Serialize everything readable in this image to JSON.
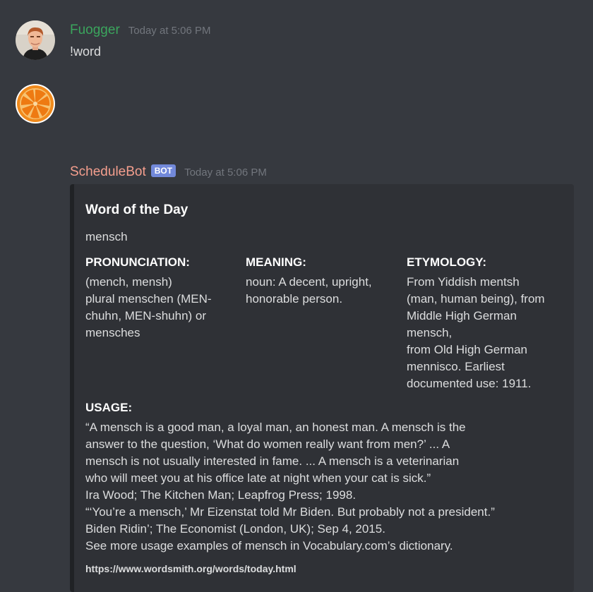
{
  "messages": [
    {
      "username": "Fuogger",
      "timestamp": "Today at 5:06 PM",
      "content": "!word"
    },
    {
      "username": "ScheduleBot",
      "bot_tag": "BOT",
      "timestamp": "Today at 5:06 PM",
      "embed": {
        "title": "Word of the Day",
        "description": "mensch",
        "fields": [
          {
            "name": "PRONUNCIATION:",
            "value": "(mench, mensh)\nplural menschen (MEN-\nchuhn, MEN-shuhn) or\nmensches"
          },
          {
            "name": "MEANING:",
            "value": "noun: A decent, upright,\nhonorable person."
          },
          {
            "name": "ETYMOLOGY:",
            "value": "From Yiddish mentsh\n(man, human being), from\nMiddle High German\nmensch,\nfrom Old High German\nmennisco. Earliest\ndocumented use: 1911."
          },
          {
            "name": "USAGE:",
            "value": "“A mensch is a good man, a loyal man, an honest man. A mensch is the\nanswer to the question, ‘What do women really want from men?’ ... A\nmensch is not usually interested in fame. ... A mensch is a veterinarian\nwho will meet you at his office late at night when your cat is sick.”\nIra Wood; The Kitchen Man; Leapfrog Press; 1998.\n“‘You’re a mensch,’ Mr Eizenstat told Mr Biden. But probably not a president.”\nBiden Ridin’; The Economist (London, UK); Sep 4, 2015.\nSee more usage examples of mensch in Vocabulary.com’s dictionary."
          }
        ],
        "link": "https://www.wordsmith.org/words/today.html"
      }
    }
  ],
  "colors": {
    "background": "#36393f",
    "embed_background": "#2f3136",
    "user_name": "#3ba55d",
    "bot_name": "#f59f8e",
    "bot_tag": "#7289da"
  },
  "icons": {
    "user_avatar": "user-avatar-photo",
    "bot_avatar": "orange-slice-avatar"
  }
}
